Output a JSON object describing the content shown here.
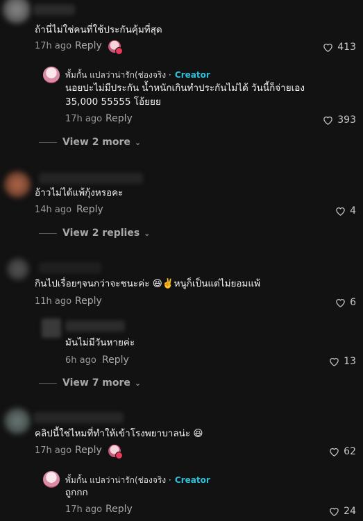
{
  "comments": [
    {
      "text": "ถ้านี่ไม่ใช่คนที่ใช้ประกันคุ้มที่สุด",
      "time": "17h ago",
      "reply_label": "Reply",
      "likes": "413"
    },
    {
      "creator_name": "พั้มกั้น แปลว่าน่ารัก(ช่องจริง ·",
      "creator_tag": "Creator",
      "text_line1": "นอยปะไม่มีประกัน น้ำหนักเกินทำประกันไม่ได้ วันนี้ก็จ่ายเอง",
      "text_line2": "35,000 55555 โอ้ยยย",
      "time": "17h ago",
      "reply_label": "Reply",
      "likes": "393"
    },
    {
      "view_more": "View 2 more"
    },
    {
      "text": "อ้าวไม่ได้แพ้กุ้งหรอคะ",
      "time": "14h ago",
      "reply_label": "Reply",
      "likes": "4"
    },
    {
      "view_more": "View 2 replies"
    },
    {
      "text": "กินไปเรื่อยๆจนกว่าจะชนะค่ะ 😆✌️หนูก็เป็นแต่ไม่ยอมแพ้",
      "time": "11h ago",
      "reply_label": "Reply",
      "likes": "6"
    },
    {
      "text": "มันไม่มีวันหายค่ะ",
      "time": "6h ago",
      "reply_label": "Reply",
      "likes": "13"
    },
    {
      "view_more": "View 7 more"
    },
    {
      "text": "คลิปนี้ใช่ไหมที่ทำให้เข้าโรงพยาบาลน่ะ 😆",
      "time": "17h ago",
      "reply_label": "Reply",
      "likes": "62"
    },
    {
      "creator_name": "พั้มกั้น แปลว่าน่ารัก(ช่องจริง ·",
      "creator_tag": "Creator",
      "text": "ถูกกก",
      "time": "17h ago",
      "reply_label": "Reply",
      "likes": "24"
    }
  ],
  "icons": {
    "like": "heart-outline-icon",
    "chevron": "chevron-down-icon"
  },
  "colors": {
    "background": "#121212",
    "creator_tag": "#2fc2dc",
    "avatar_badge": "#e93a5b"
  }
}
